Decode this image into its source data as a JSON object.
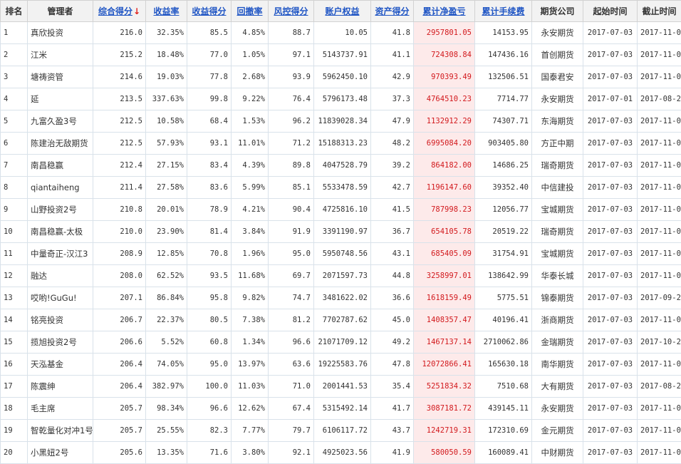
{
  "headers": [
    {
      "label": "排名",
      "sortable": false
    },
    {
      "label": "管理者",
      "sortable": false
    },
    {
      "label": "综合得分",
      "sortable": true,
      "arrow": "↓"
    },
    {
      "label": "收益率",
      "sortable": true
    },
    {
      "label": "收益得分",
      "sortable": true
    },
    {
      "label": "回撤率",
      "sortable": true
    },
    {
      "label": "风控得分",
      "sortable": true
    },
    {
      "label": "账户权益",
      "sortable": true
    },
    {
      "label": "资产得分",
      "sortable": true
    },
    {
      "label": "累计净盈亏",
      "sortable": true
    },
    {
      "label": "累计手续费",
      "sortable": true
    },
    {
      "label": "期货公司",
      "sortable": false
    },
    {
      "label": "起始时间",
      "sortable": false
    },
    {
      "label": "截止时间",
      "sortable": false
    }
  ],
  "rows": [
    [
      "1",
      "真欣投资",
      "216.0",
      "32.35%",
      "85.5",
      "4.85%",
      "88.7",
      "10.05",
      "41.8",
      "2957801.05",
      "14153.95",
      "永安期货",
      "2017-07-03",
      "2017-11-08"
    ],
    [
      "2",
      "江米",
      "215.2",
      "18.48%",
      "77.0",
      "1.05%",
      "97.1",
      "5143737.91",
      "41.1",
      "724308.84",
      "147436.16",
      "首创期货",
      "2017-07-03",
      "2017-11-08"
    ],
    [
      "3",
      "塘祷资管",
      "214.6",
      "19.03%",
      "77.8",
      "2.68%",
      "93.9",
      "5962450.10",
      "42.9",
      "970393.49",
      "132506.51",
      "国泰君安",
      "2017-07-03",
      "2017-11-08"
    ],
    [
      "4",
      "延",
      "213.5",
      "337.63%",
      "99.8",
      "9.22%",
      "76.4",
      "5796173.48",
      "37.3",
      "4764510.23",
      "7714.77",
      "永安期货",
      "2017-07-01",
      "2017-08-28"
    ],
    [
      "5",
      "九富久盈3号",
      "212.5",
      "10.58%",
      "68.4",
      "1.53%",
      "96.2",
      "11839028.34",
      "47.9",
      "1132912.29",
      "74307.71",
      "东海期货",
      "2017-07-03",
      "2017-11-08"
    ],
    [
      "6",
      "陈建治无敌期货",
      "212.5",
      "57.93%",
      "93.1",
      "11.01%",
      "71.2",
      "15188313.23",
      "48.2",
      "6995084.20",
      "903405.80",
      "方正中期",
      "2017-07-03",
      "2017-11-08"
    ],
    [
      "7",
      "南昌稳赢",
      "212.4",
      "27.15%",
      "83.4",
      "4.39%",
      "89.8",
      "4047528.79",
      "39.2",
      "864182.00",
      "14686.25",
      "瑞奇期货",
      "2017-07-03",
      "2017-11-08"
    ],
    [
      "8",
      "qiantaiheng",
      "211.4",
      "27.58%",
      "83.6",
      "5.99%",
      "85.1",
      "5533478.59",
      "42.7",
      "1196147.60",
      "39352.40",
      "中信建投",
      "2017-07-03",
      "2017-11-08"
    ],
    [
      "9",
      "山野投资2号",
      "210.8",
      "20.01%",
      "78.9",
      "4.21%",
      "90.4",
      "4725816.10",
      "41.5",
      "787998.23",
      "12056.77",
      "宝城期货",
      "2017-07-03",
      "2017-11-08"
    ],
    [
      "10",
      "南昌稳赢-太极",
      "210.0",
      "23.90%",
      "81.4",
      "3.84%",
      "91.9",
      "3391190.97",
      "36.7",
      "654105.78",
      "20519.22",
      "瑞奇期货",
      "2017-07-03",
      "2017-11-08"
    ],
    [
      "11",
      "中量奇正-汉江3",
      "208.9",
      "12.85%",
      "70.8",
      "1.96%",
      "95.0",
      "5950748.56",
      "43.1",
      "685405.09",
      "31754.91",
      "宝城期货",
      "2017-07-03",
      "2017-11-08"
    ],
    [
      "12",
      "融达",
      "208.0",
      "62.52%",
      "93.5",
      "11.68%",
      "69.7",
      "2071597.73",
      "44.8",
      "3258997.01",
      "138642.99",
      "华泰长城",
      "2017-07-03",
      "2017-11-08"
    ],
    [
      "13",
      "哎哟!GuGu!",
      "207.1",
      "86.84%",
      "95.8",
      "9.82%",
      "74.7",
      "3481622.02",
      "36.6",
      "1618159.49",
      "5775.51",
      "锦泰期货",
      "2017-07-03",
      "2017-09-22"
    ],
    [
      "14",
      "铭亮投资",
      "206.7",
      "22.37%",
      "80.5",
      "7.38%",
      "81.2",
      "7702787.62",
      "45.0",
      "1408357.47",
      "40196.41",
      "浙商期货",
      "2017-07-03",
      "2017-11-08"
    ],
    [
      "15",
      "揽旭投资2号",
      "206.6",
      "5.52%",
      "60.8",
      "1.34%",
      "96.6",
      "21071709.12",
      "49.2",
      "1467137.14",
      "2710062.86",
      "金瑞期货",
      "2017-07-03",
      "2017-10-24"
    ],
    [
      "16",
      "天泓基金",
      "206.4",
      "74.05%",
      "95.0",
      "13.97%",
      "63.6",
      "19225583.76",
      "47.8",
      "12072866.41",
      "165630.18",
      "南华期货",
      "2017-07-03",
      "2017-11-08"
    ],
    [
      "17",
      "陈震绅",
      "206.4",
      "382.97%",
      "100.0",
      "11.03%",
      "71.0",
      "2001441.53",
      "35.4",
      "5251834.32",
      "7510.68",
      "大有期货",
      "2017-07-03",
      "2017-08-28"
    ],
    [
      "18",
      "毛主席",
      "205.7",
      "98.34%",
      "96.6",
      "12.62%",
      "67.4",
      "5315492.14",
      "41.7",
      "3087181.72",
      "439145.11",
      "永安期货",
      "2017-07-03",
      "2017-11-08"
    ],
    [
      "19",
      "智乾量化对冲1号",
      "205.7",
      "25.55%",
      "82.3",
      "7.77%",
      "79.7",
      "6106117.72",
      "43.7",
      "1242719.31",
      "172310.69",
      "金元期货",
      "2017-07-03",
      "2017-11-08"
    ],
    [
      "20",
      "小黑妞2号",
      "205.6",
      "13.35%",
      "71.6",
      "3.80%",
      "92.1",
      "4925023.56",
      "41.9",
      "580050.59",
      "160089.41",
      "中财期货",
      "2017-07-03",
      "2017-11-08"
    ]
  ],
  "colors": {
    "link": "#1f55c4",
    "profit_text": "#d2191d",
    "profit_bg": "#fdeaea",
    "header_bg": "#f2f2f2",
    "sort_arrow": "#e0201b"
  }
}
